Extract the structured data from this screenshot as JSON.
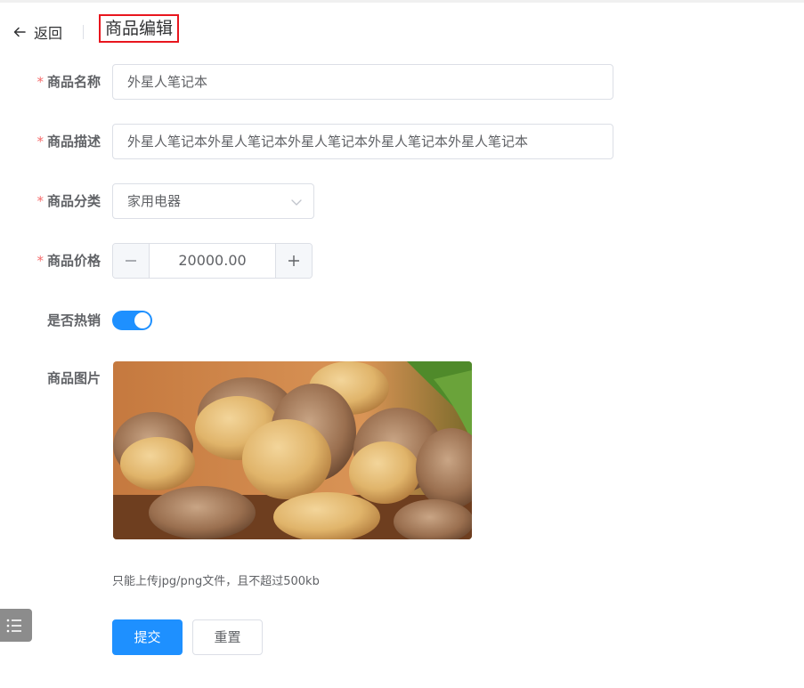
{
  "header": {
    "back_label": "返回",
    "title": "商品编辑"
  },
  "form": {
    "name": {
      "label": "商品名称",
      "required": true,
      "value": "外星人笔记本"
    },
    "description": {
      "label": "商品描述",
      "required": true,
      "value": "外星人笔记本外星人笔记本外星人笔记本外星人笔记本外星人笔记本"
    },
    "category": {
      "label": "商品分类",
      "required": true,
      "selected": "家用电器"
    },
    "price": {
      "label": "商品价格",
      "required": true,
      "value": "20000.00"
    },
    "hot_sale": {
      "label": "是否热销",
      "on": true
    },
    "image": {
      "label": "商品图片",
      "tip": "只能上传jpg/png文件，且不超过500kb"
    },
    "required_mark": "*"
  },
  "actions": {
    "submit_label": "提交",
    "reset_label": "重置"
  },
  "colors": {
    "primary": "#1e90ff",
    "required": "#f56c6c",
    "highlight_border": "#e8161e"
  },
  "icons": {
    "back": "arrow-left-icon",
    "select": "chevron-down-icon",
    "decrease": "minus-icon",
    "increase": "plus-icon",
    "menu": "list-icon"
  }
}
